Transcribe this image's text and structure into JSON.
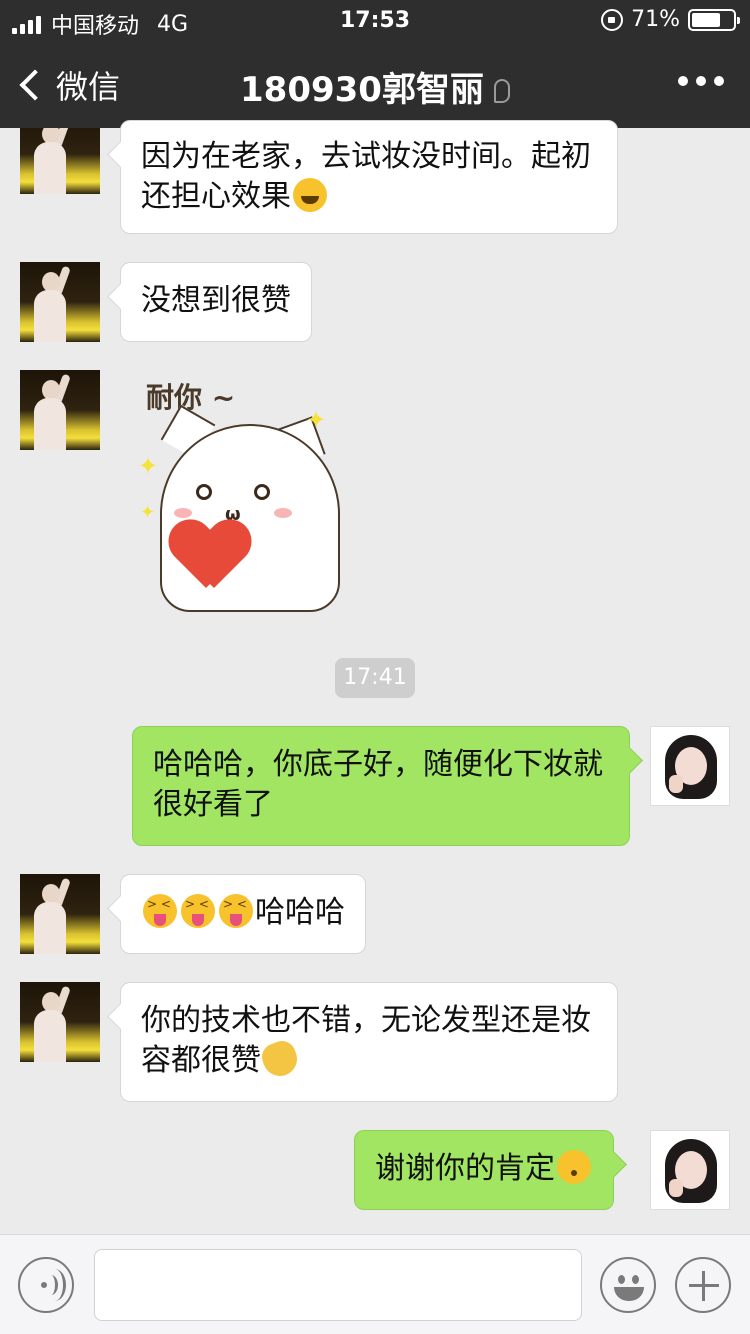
{
  "status_bar": {
    "carrier": "中国移动",
    "network": "4G",
    "time": "17:53",
    "battery": "71%",
    "battery_level": 0.71
  },
  "nav": {
    "back_label": "微信",
    "title": "180930郭智丽"
  },
  "messages": [
    {
      "side": "left",
      "text": "因为在老家，去试妆没时间。起初还担心效果"
    },
    {
      "side": "left",
      "text": "没想到很赞"
    },
    {
      "side": "left",
      "type": "sticker",
      "text": "耐你 ~"
    },
    {
      "side": "right",
      "text": "哈哈哈，你底子好，随便化下妆就很好看了"
    },
    {
      "side": "left",
      "text": "哈哈哈"
    },
    {
      "side": "left",
      "text": "你的技术也不错，无论发型还是妆容都很赞"
    },
    {
      "side": "right",
      "text": "谢谢你的肯定"
    }
  ],
  "timestamp": "17:41",
  "icons": {
    "back": "chevron-left-icon",
    "more": "more-dots-icon",
    "voice": "voice-icon",
    "emoji": "emoji-icon",
    "plus": "plus-icon"
  },
  "colors": {
    "nav_bg": "#2e2e2e",
    "chat_bg": "#ebebeb",
    "bubble_self": "#a2e563",
    "bubble_other": "#ffffff"
  }
}
